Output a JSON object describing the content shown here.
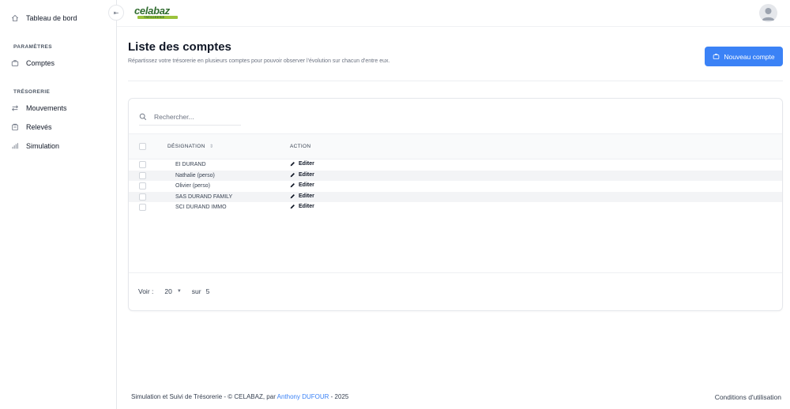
{
  "app": {
    "logo_text": "celabaz",
    "logo_tagline": "TRÉSORERIE"
  },
  "sidebar": {
    "top_item": {
      "label": "Tableau de bord",
      "icon": "home-icon"
    },
    "sections": [
      {
        "title": "PARAMÈTRES",
        "items": [
          {
            "label": "Comptes",
            "icon": "briefcase-icon"
          }
        ]
      },
      {
        "title": "TRÉSORERIE",
        "items": [
          {
            "label": "Mouvements",
            "icon": "arrows-exchange-icon"
          },
          {
            "label": "Relevés",
            "icon": "document-icon"
          },
          {
            "label": "Simulation",
            "icon": "bar-chart-icon"
          }
        ]
      }
    ],
    "collapse_glyph": "⇤"
  },
  "page": {
    "title": "Liste des comptes",
    "subtitle": "Répartissez votre trésorerie en plusieurs comptes pour pouvoir observer l'évolution sur chacun d'entre eux.",
    "new_button_label": "Nouveau compte"
  },
  "table": {
    "search_placeholder": "Rechercher...",
    "columns": {
      "designation": "DÉSIGNATION",
      "action": "ACTION"
    },
    "action_label": "Editer",
    "rows": [
      {
        "designation": "EI DURAND"
      },
      {
        "designation": "Nathalie (perso)"
      },
      {
        "designation": "Olivier (perso)"
      },
      {
        "designation": "SAS DURAND FAMILY"
      },
      {
        "designation": "SCI DURAND IMMO"
      }
    ]
  },
  "pagination": {
    "show_label": "Voir :",
    "page_size": "20",
    "of_label": "sur",
    "total": "5"
  },
  "footer": {
    "text_before": "Simulation et Suivi de Trésorerie - © CELABAZ, par ",
    "author": "Anthony DUFOUR",
    "text_after": " - 2025",
    "terms_label": "Conditions d'utilisation"
  },
  "colors": {
    "accent": "#3b82f6",
    "logo_green": "#2f6b2e",
    "logo_lime": "#9bc23c"
  }
}
